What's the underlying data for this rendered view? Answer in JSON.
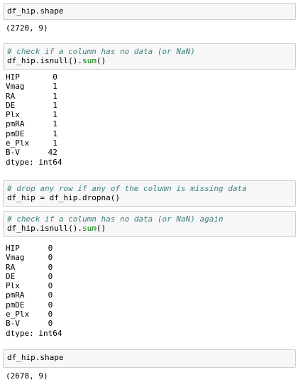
{
  "cells": [
    {
      "code": "df_hip.shape",
      "output": [
        "(2720, 9)"
      ]
    },
    {
      "comment": "# check if a column has no data (or NaN)",
      "code_pre": "df_hip.isnull().",
      "code_fn": "sum",
      "code_post": "()",
      "output": [
        "HIP       0",
        "Vmag      1",
        "RA        1",
        "DE        1",
        "Plx       1",
        "pmRA      1",
        "pmDE      1",
        "e_Plx     1",
        "B-V      42",
        "dtype: int64"
      ]
    },
    {
      "comment": "# drop any row if any of the column is missing data",
      "code": "df_hip = df_hip.dropna()"
    },
    {
      "comment": "# check if a column has no data (or NaN) again",
      "code_pre": "df_hip.isnull().",
      "code_fn": "sum",
      "code_post": "()",
      "output": [
        "HIP      0",
        "Vmag     0",
        "RA       0",
        "DE       0",
        "Plx      0",
        "pmRA     0",
        "pmDE     0",
        "e_Plx    0",
        "B-V      0",
        "dtype: int64"
      ]
    },
    {
      "code": "df_hip.shape",
      "output": [
        "(2678, 9)"
      ]
    }
  ]
}
